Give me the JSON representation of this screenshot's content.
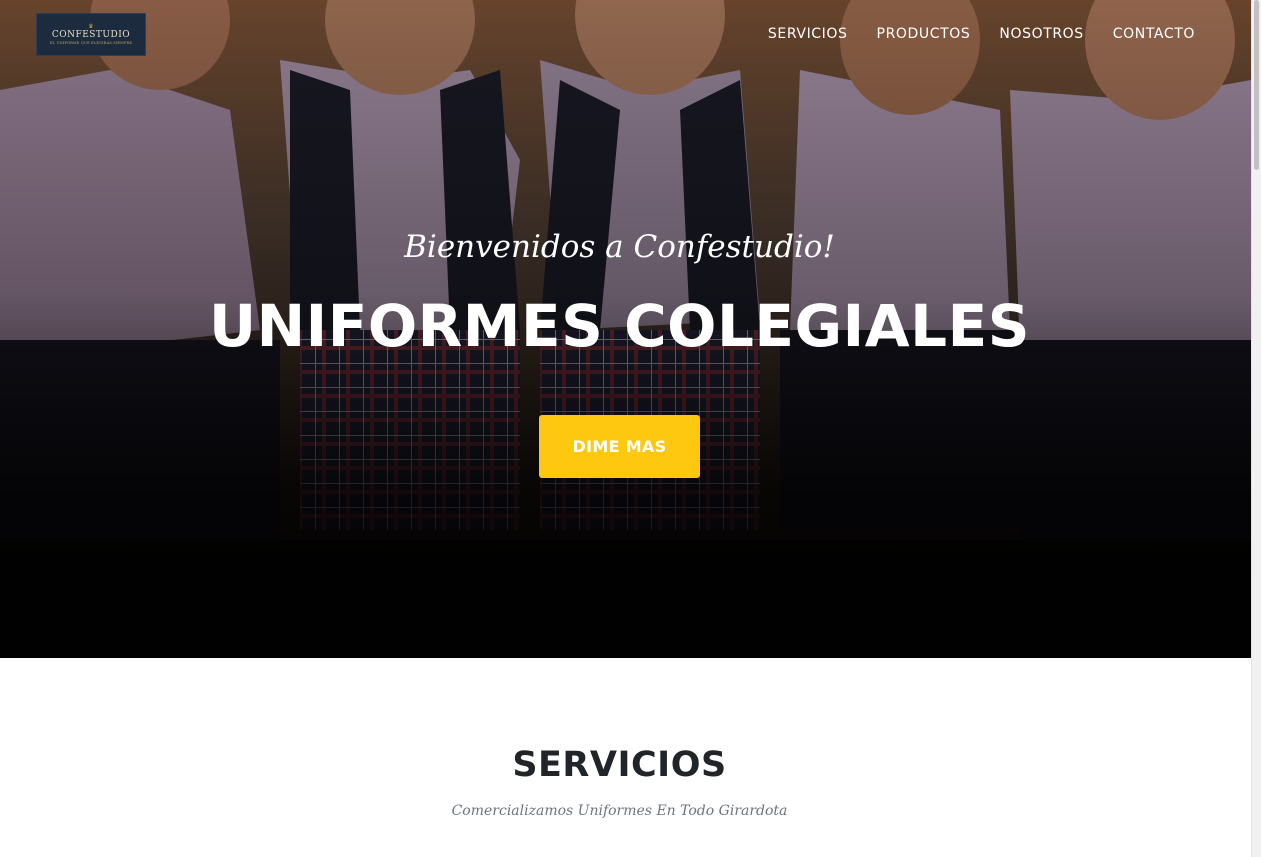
{
  "header": {
    "logo": {
      "name": "CONFESTUDIO",
      "tagline": "EL UNIFORME QUE ELEGIRÁS SIEMPRE"
    },
    "nav": [
      {
        "label": "SERVICIOS"
      },
      {
        "label": "PRODUCTOS"
      },
      {
        "label": "NOSOTROS"
      },
      {
        "label": "CONTACTO"
      }
    ]
  },
  "hero": {
    "subtitle": "Bienvenidos a Confestudio!",
    "title": "UNIFORMES COLEGIALES",
    "button_label": "DIME MAS",
    "image_description": "group-of-smiling-schoolchildren-in-uniforms"
  },
  "services": {
    "title": "SERVICIOS",
    "subtitle": "Comercializamos Uniformes En Todo Girardota"
  },
  "colors": {
    "accent": "#fec810",
    "heading": "#212529",
    "muted": "#6c757d",
    "logo_bg": "#1c2b3d"
  }
}
